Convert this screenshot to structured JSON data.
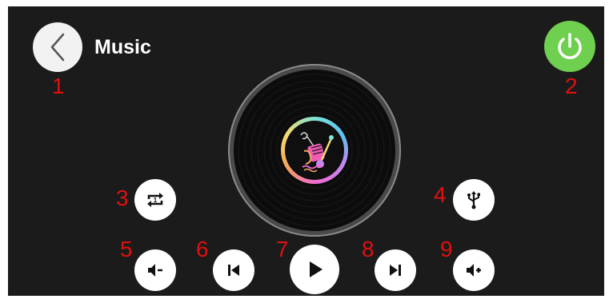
{
  "header": {
    "title": "Music"
  },
  "callouts": [
    "1",
    "2",
    "3",
    "4",
    "5",
    "6",
    "7",
    "8",
    "9"
  ],
  "colors": {
    "background": "#1b1b1b",
    "button": "#ffffff",
    "power": "#6fcf4f",
    "callout": "#e01010"
  },
  "icons": {
    "back": "chevron-left-icon",
    "power": "power-icon",
    "repeat": "repeat-one-icon",
    "usb": "usb-icon",
    "volume_down": "volume-down-icon",
    "previous": "skip-previous-icon",
    "play": "play-icon",
    "next": "skip-next-icon",
    "volume_up": "volume-up-icon",
    "album": "music-instruments-art-icon"
  }
}
